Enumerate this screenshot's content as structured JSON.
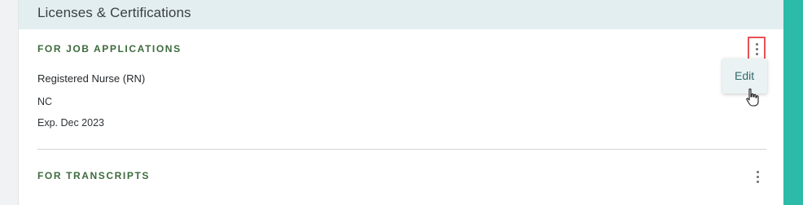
{
  "section_title": "Licenses & Certifications",
  "groups": [
    {
      "label": "FOR JOB APPLICATIONS",
      "entries": [
        {
          "name": "Registered Nurse (RN)",
          "state": "NC",
          "expiration": "Exp. Dec 2023"
        }
      ]
    },
    {
      "label": "FOR TRANSCRIPTS",
      "entries": []
    }
  ],
  "menu": {
    "items": [
      "Edit"
    ]
  },
  "colors": {
    "header_bg": "#e3eef0",
    "section_label": "#3d6b3d",
    "accent_teal": "#2cbba9",
    "highlight_red": "#e85254",
    "menu_text": "#2f6a6c"
  },
  "icons": {
    "more": "kebab-vertical-icon",
    "cursor": "hand-pointer-icon"
  }
}
